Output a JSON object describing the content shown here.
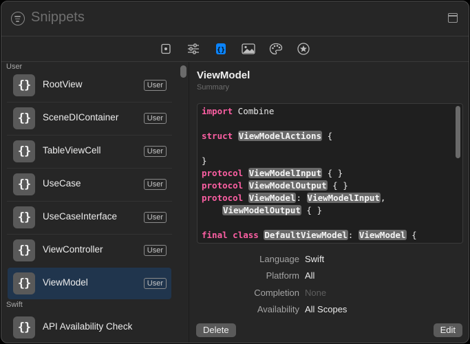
{
  "window": {
    "title": "Snippets"
  },
  "icons": {
    "search": "search-icon",
    "panel": "sidebar-panel-icon",
    "toolbar": [
      "file-icon",
      "sliders-icon",
      "braces-icon",
      "image-icon",
      "palette-icon",
      "star-icon"
    ]
  },
  "colors": {
    "accent": "#0a84ff",
    "selection": "#20354d",
    "keyword": "#fc5fa3"
  },
  "sidebar": {
    "sections": [
      {
        "title": "User"
      },
      {
        "title": "Swift"
      }
    ],
    "items": [
      {
        "glyph": "{}",
        "label": "RootView",
        "badge": "User"
      },
      {
        "glyph": "{}",
        "label": "SceneDIContainer",
        "badge": "User"
      },
      {
        "glyph": "{}",
        "label": "TableViewCell",
        "badge": "User"
      },
      {
        "glyph": "{}",
        "label": "UseCase",
        "badge": "User"
      },
      {
        "glyph": "{}",
        "label": "UseCaseInterface",
        "badge": "User"
      },
      {
        "glyph": "{}",
        "label": "ViewController",
        "badge": "User"
      },
      {
        "glyph": "{}",
        "label": "ViewModel",
        "badge": "User",
        "selected": true
      }
    ],
    "swift_items": [
      {
        "glyph": "{}",
        "label": "API Availability Check"
      }
    ]
  },
  "detail": {
    "title": "ViewModel",
    "subtitle": "Summary",
    "code": {
      "l1_kw": "import",
      "l1_rest": " Combine",
      "l3_kw": "struct",
      "l3_tok": "ViewModelActions",
      "l3_rest": " {",
      "l5": "}",
      "l6_kw": "protocol",
      "l6_tok": "ViewModelInput",
      "l6_rest": " { }",
      "l7_kw": "protocol",
      "l7_tok": "ViewModelOutput",
      "l7_rest": " { }",
      "l8_kw": "protocol",
      "l8_tok1": "ViewModel",
      "l8_mid": ": ",
      "l8_tok2": "ViewModelInput",
      "l8_rest": ",",
      "l9_tok": "ViewModelOutput",
      "l9_rest": " { }",
      "l11_kw1": "final",
      "l11_kw2": "class",
      "l11_tok1": "DefaultViewModel",
      "l11_mid": ": ",
      "l11_tok2": "ViewModel",
      "l11_rest": " {"
    },
    "meta": {
      "language_label": "Language",
      "language_value": "Swift",
      "platform_label": "Platform",
      "platform_value": "All",
      "completion_label": "Completion",
      "completion_value": "None",
      "availability_label": "Availability",
      "availability_value": "All Scopes"
    },
    "delete_label": "Delete",
    "edit_label": "Edit"
  }
}
